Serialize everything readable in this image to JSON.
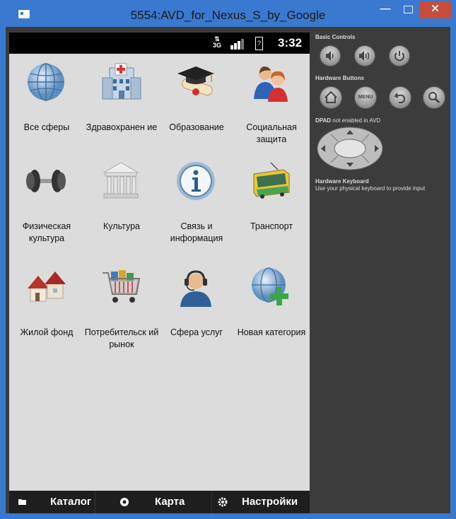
{
  "window": {
    "title": "5554:AVD_for_Nexus_S_by_Google",
    "close_label": "✕",
    "minimize_label": "—"
  },
  "statusbar": {
    "network": "3G",
    "time": "3:32",
    "battery_glyph": "?"
  },
  "categories": [
    {
      "label": "Все сферы",
      "icon": "globe-icon"
    },
    {
      "label": "Здравохранен ие",
      "icon": "hospital-icon"
    },
    {
      "label": "Образование",
      "icon": "graduation-cap-icon"
    },
    {
      "label": "Социальная защита",
      "icon": "people-icon"
    },
    {
      "label": "Физическая культура",
      "icon": "dumbbell-icon"
    },
    {
      "label": "Культура",
      "icon": "museum-icon"
    },
    {
      "label": "Связь и информация",
      "icon": "info-icon"
    },
    {
      "label": "Транспорт",
      "icon": "tram-icon"
    },
    {
      "label": "Жилой фонд",
      "icon": "houses-icon"
    },
    {
      "label": "Потребительск ий рынок",
      "icon": "shopping-cart-icon"
    },
    {
      "label": "Сфера услуг",
      "icon": "support-agent-icon"
    },
    {
      "label": "Новая категория",
      "icon": "globe-plus-icon"
    }
  ],
  "tabs": [
    {
      "label": "Каталог",
      "icon": "folder-icon"
    },
    {
      "label": "Карта",
      "icon": "map-pin-icon"
    },
    {
      "label": "Настройки",
      "icon": "gear-icon"
    }
  ],
  "panel": {
    "basic_controls": "Basic Controls",
    "hardware_buttons": "Hardware Buttons",
    "menu_label": "MENU",
    "dpad_bold": "DPAD",
    "dpad_rest": " not enabled in AVD",
    "keyboard_title": "Hardware Keyboard",
    "keyboard_desc": "Use your physical keyboard to provide input"
  }
}
